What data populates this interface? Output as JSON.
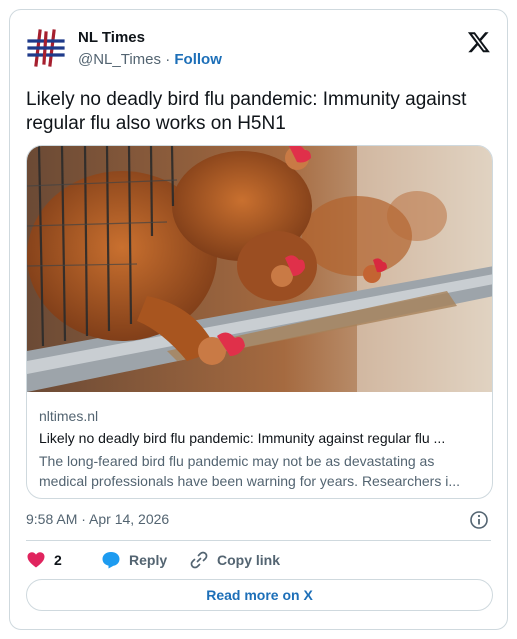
{
  "author": {
    "name": "NL Times",
    "handle": "@NL_Times",
    "separator": "·",
    "follow_label": "Follow",
    "avatar_icon": "nl-times-hash-logo-icon"
  },
  "platform_icon": "x-logo-icon",
  "tweet": {
    "text": "Likely no deadly bird flu pandemic: Immunity against regular flu also works on H5N1"
  },
  "link_card": {
    "image_subject": "chickens-in-cage-eating-from-trough",
    "domain": "nltimes.nl",
    "title": "Likely no deadly bird flu pandemic: Immunity against regular flu ...",
    "description": "The long-feared bird flu pandemic may not be as devastating as medical professionals have been warning for years. Researchers i..."
  },
  "meta": {
    "timestamp": "9:58 AM · Apr 14, 2026",
    "info_icon": "info-icon"
  },
  "actions": {
    "like_count": "2",
    "reply_label": "Reply",
    "copy_label": "Copy link"
  },
  "read_more_label": "Read more on X",
  "colors": {
    "accent": "#1d6fb8",
    "heart": "#e0245e",
    "reply_bubble": "#1d9bf0",
    "border": "#cfd9de",
    "secondary_text": "#536471"
  }
}
